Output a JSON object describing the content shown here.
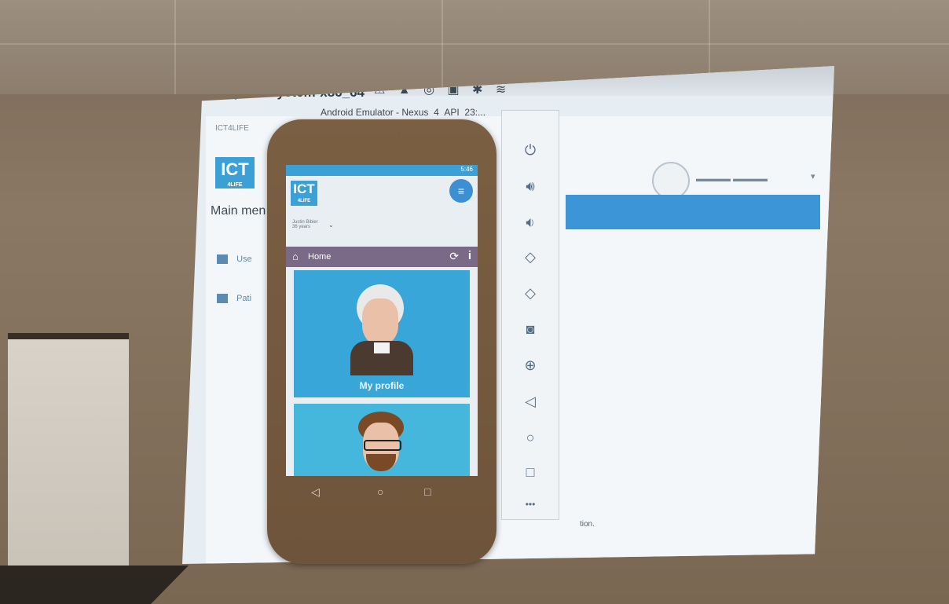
{
  "mac_bar": {
    "app_title": "qemu-system-x86_64",
    "tray_icons": [
      "adobe-icon",
      "drive-icon",
      "bluetooth-icon",
      "wifi-icon"
    ],
    "tray_text": ""
  },
  "emulator": {
    "window_title": "Android Emulator - Nexus_4_API_23:..."
  },
  "background_web": {
    "tab": "ICT4LIFE",
    "main_menu": "Main men",
    "menu_items": [
      "Use",
      "Pati"
    ],
    "logo_text": "ICT",
    "logo_sub": "4LIFE",
    "text_line": "tion."
  },
  "phone_app": {
    "logo_text": "ICT",
    "logo_sub": "4LIFE",
    "status_time": "5:46",
    "user_name": "Justin Bibier",
    "user_age": "36 years",
    "nav_label": "Home",
    "cards": [
      {
        "label": "My profile"
      },
      {
        "label": ""
      }
    ]
  },
  "emulator_side_panel": {
    "icons": [
      "power-icon",
      "volume-up-icon",
      "volume-down-icon",
      "rotate-left-icon",
      "rotate-right-icon",
      "camera-icon",
      "zoom-icon",
      "back-icon",
      "home-icon",
      "overview-icon",
      "more-icon"
    ]
  },
  "colors": {
    "accent": "#3aa0d6",
    "nav_bar": "#7a6a88",
    "phone_body": "#7b5f43"
  }
}
